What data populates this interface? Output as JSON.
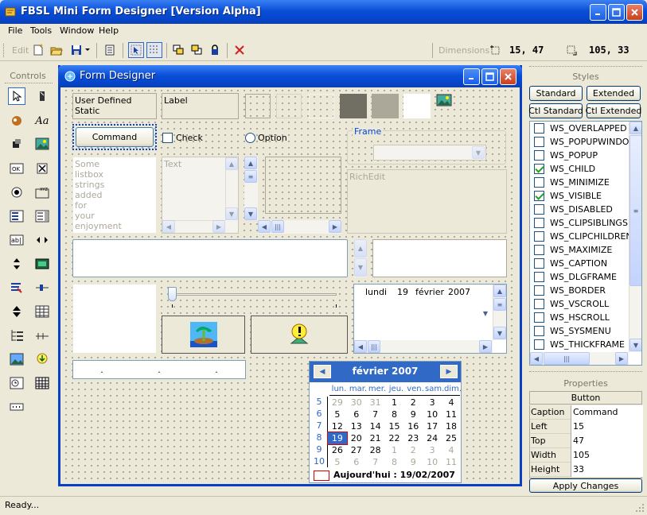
{
  "app": {
    "title": "FBSL Mini Form Designer [Version Alpha]"
  },
  "menu": [
    "File",
    "Tools",
    "Window",
    "Help"
  ],
  "toolbar": {
    "edit_label": "Edit",
    "dimensions_label": "Dimensions",
    "pos": "15, 47",
    "size": "105, 33"
  },
  "controls": {
    "heading": "Controls"
  },
  "designer": {
    "title": "Form Designer",
    "user_static": "User Defined Static",
    "label": "Label",
    "command": "Command",
    "check": "Check",
    "option": "Option",
    "frame": "Frame",
    "listbox_items": [
      "Some",
      "listbox",
      "strings",
      "added",
      "for",
      "your",
      "enjoyment"
    ],
    "textbox": "Text",
    "richedit": "RichEdit",
    "date": {
      "day": "lundi",
      "num": "19",
      "month": "février",
      "year": "2007"
    },
    "calendar": {
      "title": "février 2007",
      "days": [
        "lun.",
        "mar.",
        "mer.",
        "jeu.",
        "ven.",
        "sam.",
        "dim."
      ],
      "weeks": [
        "5",
        "6",
        "7",
        "8",
        "9",
        "10"
      ],
      "rows": [
        [
          "29",
          "30",
          "31",
          "1",
          "2",
          "3",
          "4"
        ],
        [
          "5",
          "6",
          "7",
          "8",
          "9",
          "10",
          "11"
        ],
        [
          "12",
          "13",
          "14",
          "15",
          "16",
          "17",
          "18"
        ],
        [
          "19",
          "20",
          "21",
          "22",
          "23",
          "24",
          "25"
        ],
        [
          "26",
          "27",
          "28",
          "1",
          "2",
          "3",
          "4"
        ],
        [
          "5",
          "6",
          "7",
          "8",
          "9",
          "10",
          "11"
        ]
      ],
      "today": "Aujourd'hui : 19/02/2007"
    }
  },
  "styles": {
    "heading": "Styles",
    "btn_standard": "Standard",
    "btn_extended": "Extended",
    "btn_ctl_standard": "Ctl Standard",
    "btn_ctl_extended": "Ctl Extended",
    "items": [
      {
        "name": "WS_OVERLAPPED",
        "checked": false
      },
      {
        "name": "WS_POPUPWINDO",
        "checked": false
      },
      {
        "name": "WS_POPUP",
        "checked": false
      },
      {
        "name": "WS_CHILD",
        "checked": true
      },
      {
        "name": "WS_MINIMIZE",
        "checked": false
      },
      {
        "name": "WS_VISIBLE",
        "checked": true
      },
      {
        "name": "WS_DISABLED",
        "checked": false
      },
      {
        "name": "WS_CLIPSIBLINGS",
        "checked": false
      },
      {
        "name": "WS_CLIPCHILDREN",
        "checked": false
      },
      {
        "name": "WS_MAXIMIZE",
        "checked": false
      },
      {
        "name": "WS_CAPTION",
        "checked": false
      },
      {
        "name": "WS_DLGFRAME",
        "checked": false
      },
      {
        "name": "WS_BORDER",
        "checked": false
      },
      {
        "name": "WS_VSCROLL",
        "checked": false
      },
      {
        "name": "WS_HSCROLL",
        "checked": false
      },
      {
        "name": "WS_SYSMENU",
        "checked": false
      },
      {
        "name": "WS_THICKFRAME",
        "checked": false
      }
    ]
  },
  "properties": {
    "heading": "Properties",
    "type": "Button",
    "rows": [
      {
        "label": "Caption",
        "value": "Command"
      },
      {
        "label": "Left",
        "value": "15"
      },
      {
        "label": "Top",
        "value": "47"
      },
      {
        "label": "Width",
        "value": "105"
      },
      {
        "label": "Height",
        "value": "33"
      }
    ],
    "apply": "Apply Changes"
  },
  "status": {
    "text": "Ready..."
  }
}
